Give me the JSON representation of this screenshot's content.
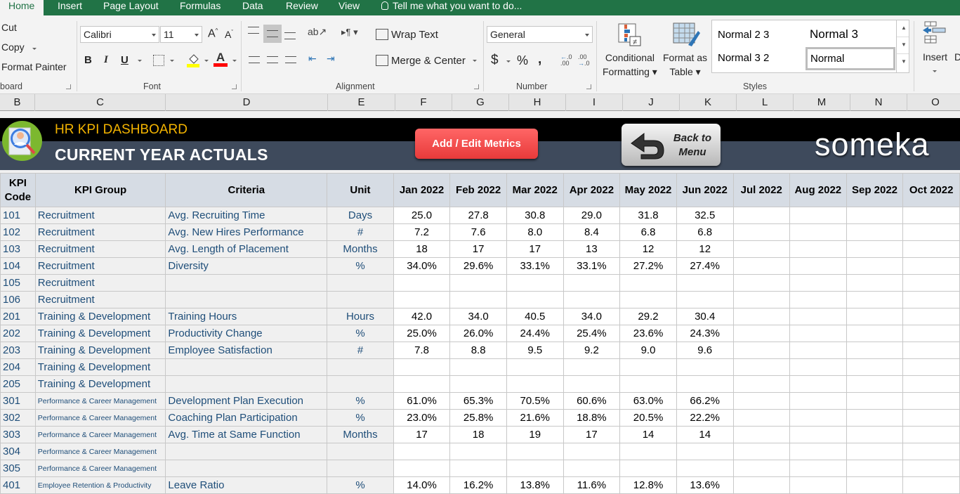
{
  "ribbon": {
    "tabs": [
      "Home",
      "Insert",
      "Page Layout",
      "Formulas",
      "Data",
      "Review",
      "View"
    ],
    "tell_me": "Tell me what you want to do...",
    "clipboard": {
      "cut": "Cut",
      "copy": "Copy",
      "format_painter": "Format Painter",
      "group_label": "board"
    },
    "font": {
      "name": "Calibri",
      "size": "11",
      "group_label": "Font",
      "fill_color": "#ffff00",
      "font_color": "#ff0000"
    },
    "alignment": {
      "wrap_text": "Wrap Text",
      "merge_center": "Merge & Center",
      "group_label": "Alignment"
    },
    "number": {
      "format": "General",
      "currency": "$",
      "percent": "%",
      "comma": ",",
      "group_label": "Number"
    },
    "styles": {
      "conditional_formatting": [
        "Conditional",
        "Formatting"
      ],
      "format_as_table": [
        "Format as",
        "Table"
      ],
      "items": [
        "Normal 2 3",
        "Normal 3",
        "Normal 3 2",
        "Normal"
      ],
      "group_label": "Styles"
    },
    "cells": {
      "insert": "Insert"
    }
  },
  "columns": [
    "B",
    "C",
    "D",
    "E",
    "F",
    "G",
    "H",
    "I",
    "J",
    "K",
    "L",
    "M",
    "N",
    "O"
  ],
  "banner": {
    "app_title": "HR KPI DASHBOARD",
    "page_title": "CURRENT YEAR ACTUALS",
    "add_button": "Add / Edit Metrics",
    "back_button": [
      "Back to",
      "Menu"
    ],
    "brand": "someka"
  },
  "table": {
    "headers": [
      "KPI Code",
      "KPI Group",
      "Criteria",
      "Unit",
      "Jan 2022",
      "Feb 2022",
      "Mar 2022",
      "Apr 2022",
      "May 2022",
      "Jun 2022",
      "Jul 2022",
      "Aug 2022",
      "Sep 2022",
      "Oct 2022"
    ],
    "rows": [
      {
        "code": "101",
        "group": "Recruitment",
        "criteria": "Avg. Recruiting Time",
        "unit": "Days",
        "values": [
          "25.0",
          "27.8",
          "30.8",
          "29.0",
          "31.8",
          "32.5",
          "",
          "",
          "",
          ""
        ]
      },
      {
        "code": "102",
        "group": "Recruitment",
        "criteria": "Avg. New Hires Performance",
        "unit": "#",
        "values": [
          "7.2",
          "7.6",
          "8.0",
          "8.4",
          "6.8",
          "6.8",
          "",
          "",
          "",
          ""
        ]
      },
      {
        "code": "103",
        "group": "Recruitment",
        "criteria": "Avg. Length of Placement",
        "unit": "Months",
        "values": [
          "18",
          "17",
          "17",
          "13",
          "12",
          "12",
          "",
          "",
          "",
          ""
        ]
      },
      {
        "code": "104",
        "group": "Recruitment",
        "criteria": "Diversity",
        "unit": "%",
        "values": [
          "34.0%",
          "29.6%",
          "33.1%",
          "33.1%",
          "27.2%",
          "27.4%",
          "",
          "",
          "",
          ""
        ]
      },
      {
        "code": "105",
        "group": "Recruitment",
        "criteria": "",
        "unit": "",
        "values": [
          "",
          "",
          "",
          "",
          "",
          "",
          "",
          "",
          "",
          ""
        ]
      },
      {
        "code": "106",
        "group": "Recruitment",
        "criteria": "",
        "unit": "",
        "values": [
          "",
          "",
          "",
          "",
          "",
          "",
          "",
          "",
          "",
          ""
        ]
      },
      {
        "code": "201",
        "group": "Training & Development",
        "criteria": "Training Hours",
        "unit": "Hours",
        "values": [
          "42.0",
          "34.0",
          "40.5",
          "34.0",
          "29.2",
          "30.4",
          "",
          "",
          "",
          ""
        ]
      },
      {
        "code": "202",
        "group": "Training & Development",
        "criteria": "Productivity Change",
        "unit": "%",
        "values": [
          "25.0%",
          "26.0%",
          "24.4%",
          "25.4%",
          "23.6%",
          "24.3%",
          "",
          "",
          "",
          ""
        ]
      },
      {
        "code": "203",
        "group": "Training & Development",
        "criteria": "Employee Satisfaction",
        "unit": "#",
        "values": [
          "7.8",
          "8.8",
          "9.5",
          "9.2",
          "9.0",
          "9.6",
          "",
          "",
          "",
          ""
        ]
      },
      {
        "code": "204",
        "group": "Training & Development",
        "criteria": "",
        "unit": "",
        "values": [
          "",
          "",
          "",
          "",
          "",
          "",
          "",
          "",
          "",
          ""
        ]
      },
      {
        "code": "205",
        "group": "Training & Development",
        "criteria": "",
        "unit": "",
        "values": [
          "",
          "",
          "",
          "",
          "",
          "",
          "",
          "",
          "",
          ""
        ]
      },
      {
        "code": "301",
        "group": "Performance & Career Management",
        "criteria": "Development Plan Execution",
        "unit": "%",
        "values": [
          "61.0%",
          "65.3%",
          "70.5%",
          "60.6%",
          "63.0%",
          "66.2%",
          "",
          "",
          "",
          ""
        ]
      },
      {
        "code": "302",
        "group": "Performance & Career Management",
        "criteria": "Coaching Plan Participation",
        "unit": "%",
        "values": [
          "23.0%",
          "25.8%",
          "21.6%",
          "18.8%",
          "20.5%",
          "22.2%",
          "",
          "",
          "",
          ""
        ]
      },
      {
        "code": "303",
        "group": "Performance & Career Management",
        "criteria": "Avg. Time at Same Function",
        "unit": "Months",
        "values": [
          "17",
          "18",
          "19",
          "17",
          "14",
          "14",
          "",
          "",
          "",
          ""
        ]
      },
      {
        "code": "304",
        "group": "Performance & Career Management",
        "criteria": "",
        "unit": "",
        "values": [
          "",
          "",
          "",
          "",
          "",
          "",
          "",
          "",
          "",
          ""
        ]
      },
      {
        "code": "305",
        "group": "Performance & Career Management",
        "criteria": "",
        "unit": "",
        "values": [
          "",
          "",
          "",
          "",
          "",
          "",
          "",
          "",
          "",
          ""
        ]
      },
      {
        "code": "401",
        "group": "Employee Retention & Productivity",
        "criteria": "Leave Ratio",
        "unit": "%",
        "values": [
          "14.0%",
          "16.2%",
          "13.8%",
          "11.6%",
          "12.8%",
          "13.6%",
          "",
          "",
          "",
          ""
        ]
      }
    ]
  }
}
